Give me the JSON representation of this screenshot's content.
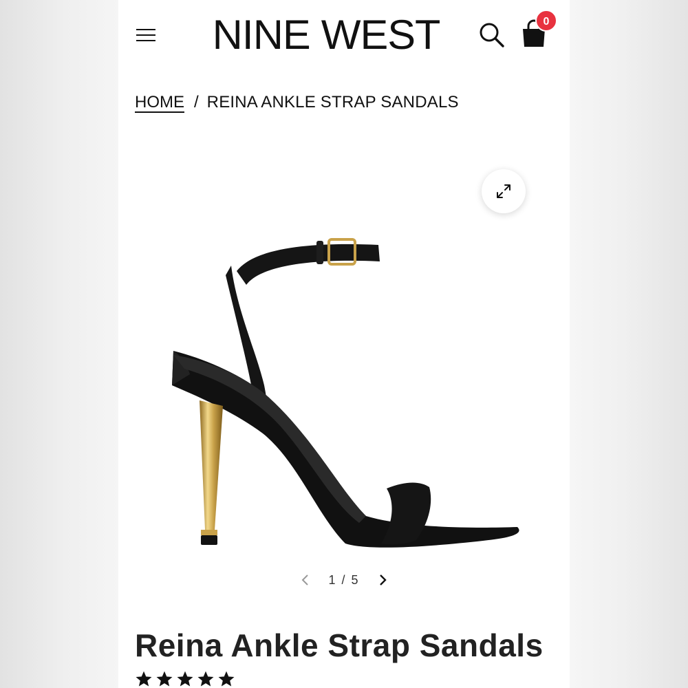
{
  "header": {
    "brand": "NINE WEST",
    "cart_count": "0",
    "badge_color": "#e8323f"
  },
  "breadcrumb": {
    "home": "HOME",
    "separator": "/",
    "current": "REINA ANKLE STRAP SANDALS"
  },
  "gallery": {
    "current_image": "1",
    "separator": "/",
    "total_images": "5",
    "heel_color": "#c9a24a",
    "shoe_color": "#151515"
  },
  "product": {
    "title": "Reina Ankle Strap Sandals",
    "rating_stars": 5
  },
  "icons": [
    "menu-icon",
    "search-icon",
    "shopping-bag-icon",
    "expand-icon",
    "chevron-left-icon",
    "chevron-right-icon",
    "star-icon"
  ]
}
